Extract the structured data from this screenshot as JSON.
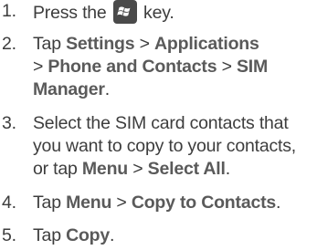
{
  "steps": [
    {
      "num": "1.",
      "parts": {
        "a": "Press the",
        "b": "key."
      },
      "icon": "windows-logo-key-icon"
    },
    {
      "num": "2.",
      "parts": {
        "tap": "Tap",
        "settings": "Settings",
        "sep1": ">",
        "applications": "Applications",
        "sep2": ">",
        "phone_contacts": "Phone and Contacts",
        "sep3": ">",
        "sim1": "SIM",
        "manager": "Manager",
        "period": "."
      }
    },
    {
      "num": "3.",
      "parts": {
        "l1": "Select the SIM card contacts that",
        "l2": "you want to copy to your contacts,",
        "or_tap": "or tap",
        "menu": "Menu",
        "sep": ">",
        "select_all": "Select All",
        "period": "."
      }
    },
    {
      "num": "4.",
      "parts": {
        "tap": "Tap",
        "menu": "Menu",
        "sep": ">",
        "copy_to_contacts": "Copy to Contacts",
        "period": "."
      }
    },
    {
      "num": "5.",
      "parts": {
        "tap": "Tap",
        "copy": "Copy",
        "period": "."
      }
    }
  ]
}
